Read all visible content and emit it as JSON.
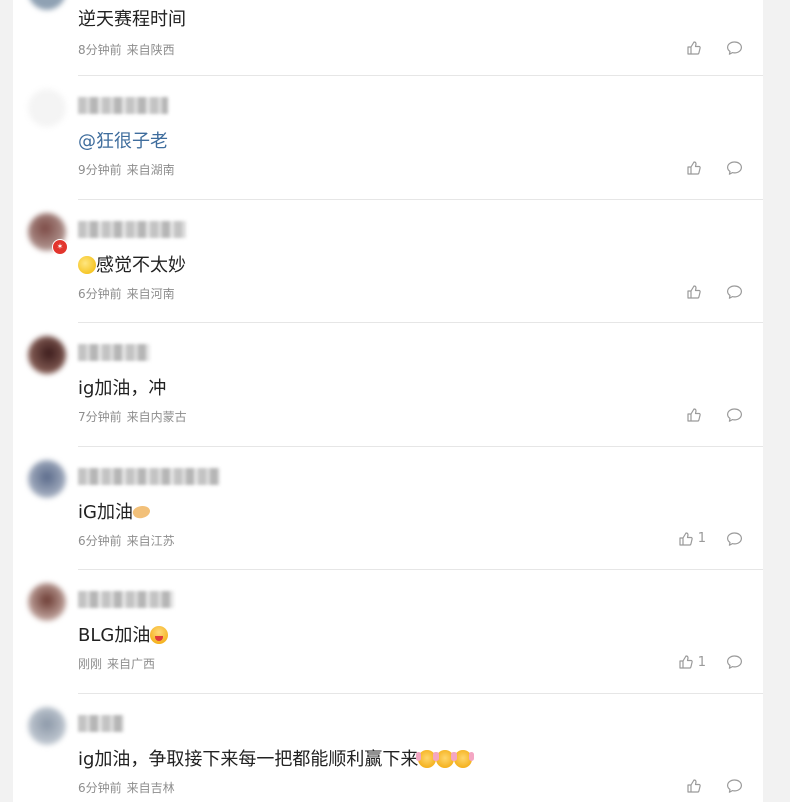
{
  "comments": [
    {
      "text": "逆天赛程时间",
      "time": "8分钟前",
      "location": "来自陕西",
      "likes": ""
    },
    {
      "text": "@狂很子老",
      "time": "9分钟前",
      "location": "来自湖南",
      "likes": ""
    },
    {
      "text": "感觉不太妙",
      "time": "6分钟前",
      "location": "来自河南",
      "likes": ""
    },
    {
      "text": "ig加油，冲",
      "time": "7分钟前",
      "location": "来自内蒙古",
      "likes": ""
    },
    {
      "text": "iG加油",
      "time": "6分钟前",
      "location": "来自江苏",
      "likes": "1"
    },
    {
      "text": "BLG加油",
      "time": "刚刚",
      "location": "来自广西",
      "likes": "1"
    },
    {
      "text": "ig加油，争取接下来每一把都能顺利赢下来",
      "time": "6分钟前",
      "location": "来自吉林",
      "likes": ""
    }
  ],
  "colors": {
    "mention": "#3f6d9d",
    "meta": "#8e8e8e",
    "badge": "#e2352d"
  },
  "icons": {
    "like": "thumbs-up-icon",
    "reply": "speech-bubble-icon",
    "verified": "verified-badge-icon"
  }
}
